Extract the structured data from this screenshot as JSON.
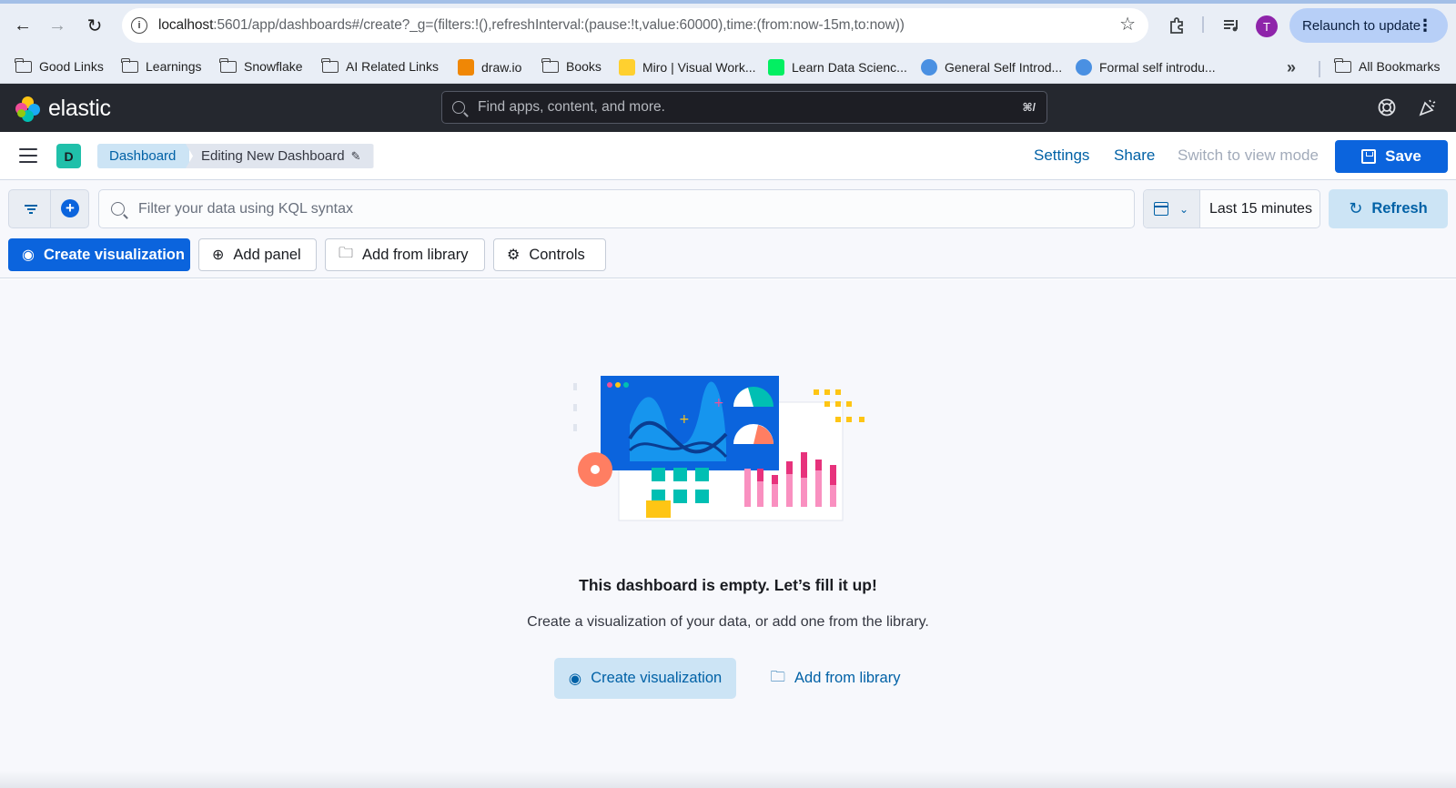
{
  "browser": {
    "url_host": "localhost",
    "url_rest": ":5601/app/dashboards#/create?_g=(filters:!(),refreshInterval:(pause:!t,value:60000),time:(from:now-15m,to:now))",
    "profile_initial": "T",
    "relaunch_label": "Relaunch to update",
    "bookmarks": [
      {
        "label": "Good Links",
        "icon": "folder-icon"
      },
      {
        "label": "Learnings",
        "icon": "folder-icon"
      },
      {
        "label": "Snowflake",
        "icon": "folder-icon"
      },
      {
        "label": "AI Related Links",
        "icon": "folder-icon"
      },
      {
        "label": "draw.io",
        "icon": "drawio-icon"
      },
      {
        "label": "Books",
        "icon": "folder-icon"
      },
      {
        "label": "Miro | Visual Work...",
        "icon": "miro-icon"
      },
      {
        "label": "Learn Data Scienc...",
        "icon": "datacamp-icon"
      },
      {
        "label": "General Self Introd...",
        "icon": "people-icon"
      },
      {
        "label": "Formal self introdu...",
        "icon": "people-icon"
      }
    ],
    "more_bookmarks": "»",
    "all_bookmarks": "All Bookmarks"
  },
  "header": {
    "brand": "elastic",
    "search_placeholder": "Find apps, content, and more.",
    "search_shortcut": "⌘/"
  },
  "appbar": {
    "space_initial": "D",
    "breadcrumbs": [
      "Dashboard",
      "Editing New Dashboard"
    ],
    "settings": "Settings",
    "share": "Share",
    "switch_mode": "Switch to view mode",
    "save": "Save"
  },
  "querybar": {
    "kql_placeholder": "Filter your data using KQL syntax",
    "time_range": "Last 15 minutes",
    "refresh": "Refresh"
  },
  "toolbar": {
    "create_visualization": "Create visualization",
    "add_panel": "Add panel",
    "add_from_library": "Add from library",
    "controls": "Controls"
  },
  "empty_state": {
    "title": "This dashboard is empty. Let’s fill it up!",
    "subtitle": "Create a visualization of your data, or add one from the library.",
    "create_visualization": "Create visualization",
    "add_from_library": "Add from library"
  },
  "colors": {
    "primary": "#0b64dd",
    "link": "#0061a6",
    "header_bg": "#25282f",
    "space_badge": "#20c0aa"
  }
}
